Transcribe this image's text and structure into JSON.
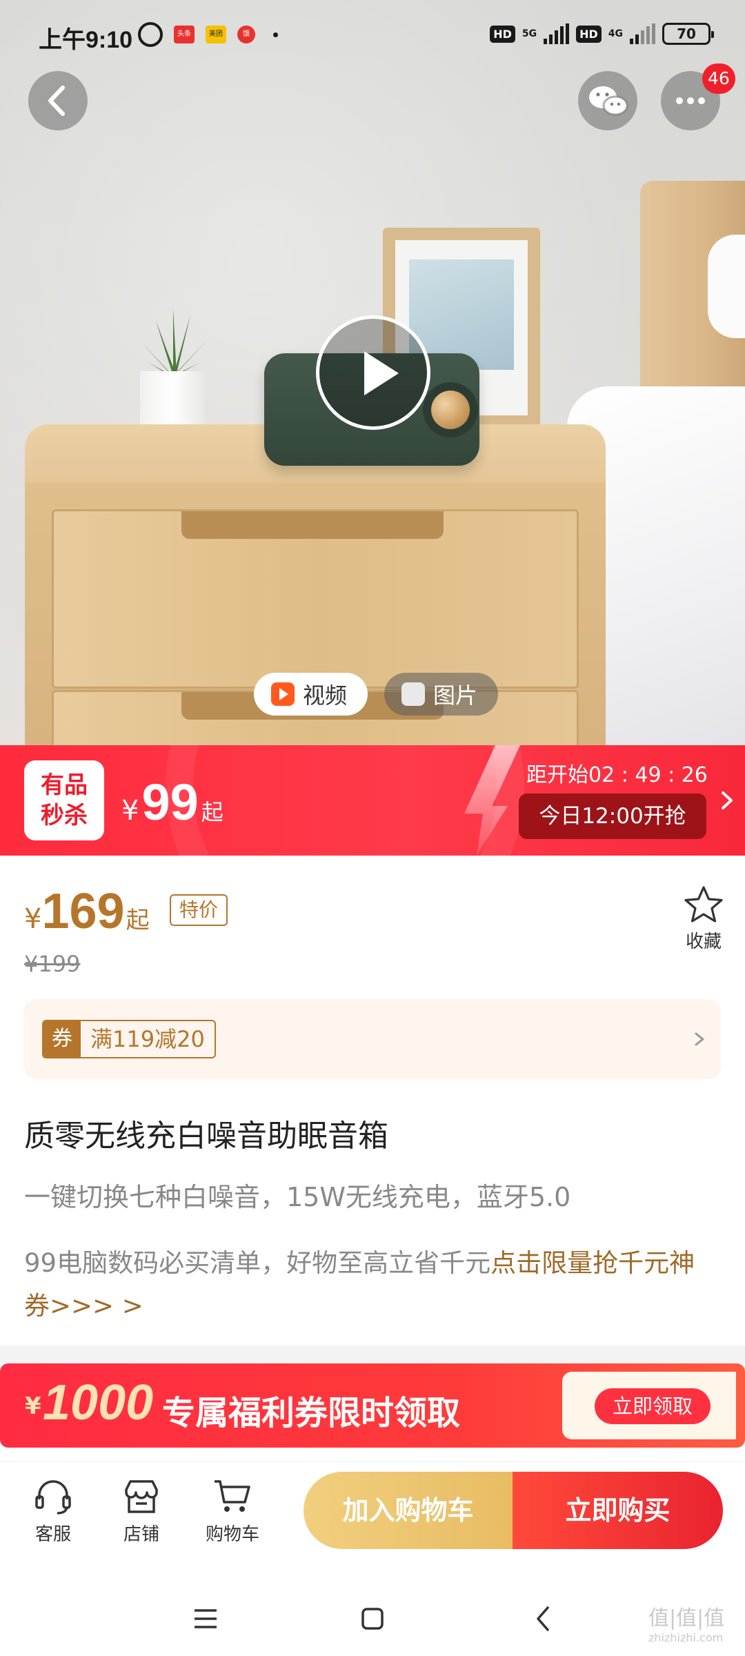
{
  "status_bar": {
    "time": "上午9:10",
    "app_icons": [
      "头条",
      "美团",
      "饿"
    ],
    "hd1": "HD",
    "net1": "5G",
    "hd2": "HD",
    "net2": "4G",
    "battery": "70"
  },
  "hero": {
    "badge_count": "46",
    "tabs": [
      {
        "label": "视频",
        "active": true
      },
      {
        "label": "图片",
        "active": false
      }
    ]
  },
  "flash_sale": {
    "tag_line1": "有品",
    "tag_line2": "秒杀",
    "currency": "¥",
    "price": "99",
    "price_suffix": "起",
    "countdown": "距开始02 : 49 : 26",
    "start_time": "今日12:00开抢"
  },
  "product": {
    "currency": "¥",
    "price": "169",
    "price_suffix": "起",
    "special_tag": "特价",
    "original_price": "¥199",
    "favorite_label": "收藏",
    "coupon_key": "券",
    "coupon_value": "满119减20",
    "title": "质零无线充白噪音助眠音箱",
    "subtitle": "一键切换七种白噪音，15W无线充电，蓝牙5.0",
    "promo_text": "99电脑数码必买清单，好物至高立省千元",
    "promo_highlight": "点击限量抢千元神券>>> >"
  },
  "welfare_banner": {
    "currency": "¥",
    "amount": "1000",
    "text": "专属福利券限时领取",
    "claim_label": "立即领取"
  },
  "bottom_bar": {
    "service_label": "客服",
    "shop_label": "店铺",
    "cart_label": "购物车",
    "add_cart_label": "加入购物车",
    "buy_now_label": "立即购买"
  },
  "watermark": {
    "main": "值|值|值",
    "sub": "zhizhizhi.com"
  },
  "colors": {
    "flash_red": "#ff2b3d",
    "price_gold": "#b5762b",
    "add_cart": "#e8bc63",
    "buy_now": "#e9232f"
  }
}
